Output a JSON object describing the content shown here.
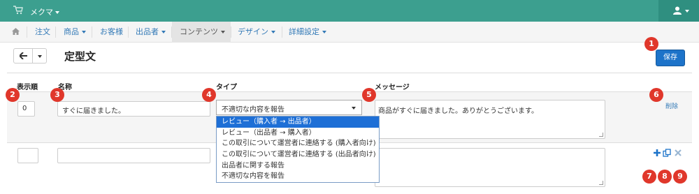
{
  "topbar": {
    "brand": "メクマ"
  },
  "nav": {
    "items": [
      "注文",
      "商品",
      "お客様",
      "出品者",
      "コンテンツ",
      "デザイン",
      "詳細設定"
    ]
  },
  "page": {
    "title": "定型文",
    "save_label": "保存"
  },
  "table": {
    "headers": {
      "order": "表示順",
      "name": "名称",
      "type": "タイプ",
      "message": "メッセージ"
    },
    "rows": [
      {
        "order": "0",
        "name": "すぐに届きました。",
        "type": "不適切な内容を報告",
        "message": "商品がすぐに届きました。ありがとうございます。",
        "delete_label": "削除"
      },
      {
        "order": "",
        "name": "",
        "type": "",
        "message": ""
      }
    ]
  },
  "type_options": [
    "レビュー（購入者 → 出品者）",
    "レビュー（出品者 → 購入者）",
    "この取引について運営者に連絡する (購入者向け)",
    "この取引について運営者に連絡する (出品者向け)",
    "出品者に関する報告",
    "不適切な内容を報告"
  ],
  "badges": [
    "1",
    "2",
    "3",
    "4",
    "5",
    "6",
    "7",
    "8",
    "9"
  ],
  "colors": {
    "topbar": "#3c9f8f",
    "primary": "#1d73c9",
    "badge": "#e0372b",
    "link": "#337ab7",
    "selected_option": "#1e6fd6"
  }
}
